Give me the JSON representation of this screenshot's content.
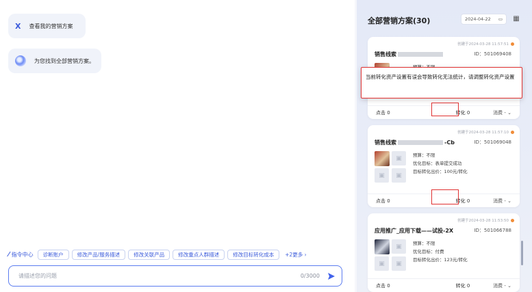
{
  "chat": {
    "user_message": "查看我的营销方案",
    "bot_message": "为您找到全部营销方案。",
    "command_center": "指令中心",
    "quick_actions": [
      "诊断账户",
      "修改产品/服务描述",
      "修改关联产品",
      "修改重点人群描述",
      "修改目标转化成本"
    ],
    "more": "+2更多",
    "input_placeholder": "请描述您的问题",
    "counter": "0/3000"
  },
  "panel": {
    "title": "全部营销方案(30)",
    "date": "2024-04-22",
    "tooltip": "当前转化资产设置有误会导致转化无法统计，请调整转化资产设置",
    "cards": [
      {
        "created": "创建于2024-03-28 11:57:51",
        "name_prefix": "销售线索",
        "name_suffix": "",
        "id": "ID：501069408",
        "budget": "预算：不限",
        "clicks": "点击 0",
        "conversions": "转化 0",
        "cost": "消费 -"
      },
      {
        "created": "创建于2024-03-28 11:57:10",
        "name_prefix": "销售线索",
        "name_suffix": "-Cb",
        "id": "ID：501069048",
        "budget": "预算：不限",
        "goal": "优化目标：表单提交成功",
        "bid": "目标转化出价：100元/转化",
        "clicks": "点击 0",
        "conversions": "转化 0",
        "cost": "消费 -"
      },
      {
        "created": "创建于2024-03-28 11:53:50",
        "name": "应用推广_应用下载——试投-2X",
        "id": "ID：501066788",
        "budget": "预算：不限",
        "goal": "优化目标：付费",
        "bid": "目标转化出价：123元/转化",
        "clicks": "点击 0",
        "conversions": "转化 0",
        "cost": "消费 -"
      }
    ]
  },
  "colors": {
    "accent": "#3b5bdb",
    "highlight": "#e03131",
    "created_dot": "#f08c38"
  },
  "icons": [
    "close-x-icon",
    "bot-avatar-icon",
    "command-icon",
    "send-icon",
    "calendar-icon",
    "grid-icon",
    "image-placeholder-icon",
    "dot-icon"
  ]
}
